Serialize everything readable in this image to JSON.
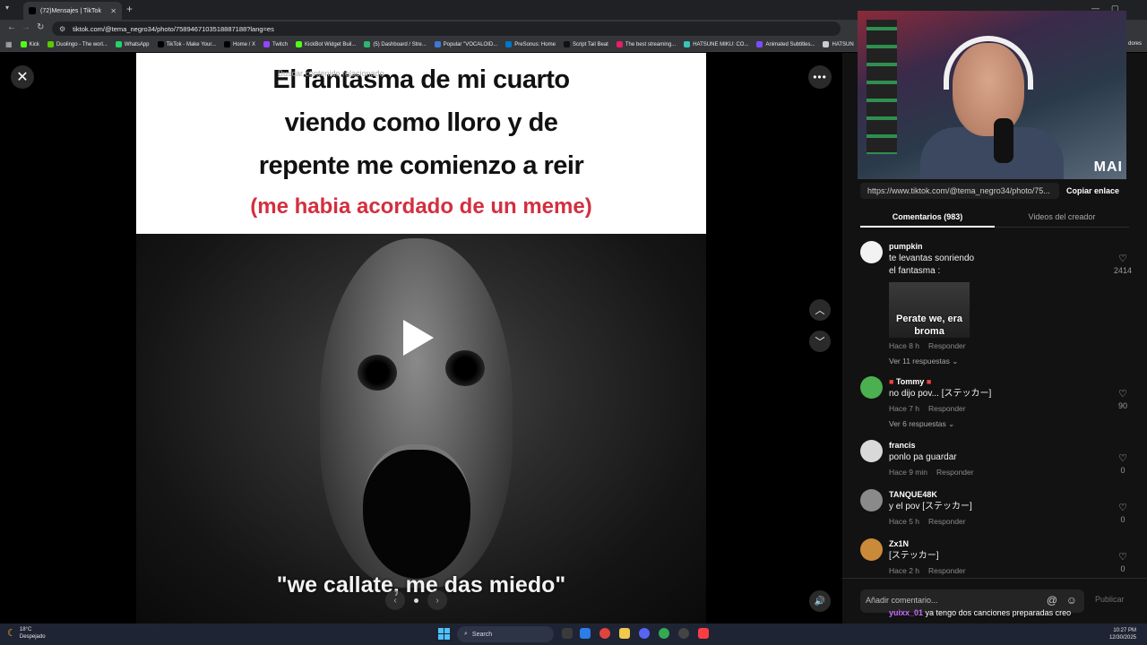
{
  "browser": {
    "tab_title": "(72)Mensajes | TikTok",
    "url": "tiktok.com/@tema_negro34/photo/7589467103518887188?lang=es",
    "bookmarks": [
      {
        "label": "Kick",
        "color": "#53fc18"
      },
      {
        "label": "Duolingo - The worl...",
        "color": "#58cc02"
      },
      {
        "label": "WhatsApp",
        "color": "#25d366"
      },
      {
        "label": "TikTok - Make Your...",
        "color": "#000000"
      },
      {
        "label": "Home / X",
        "color": "#000000"
      },
      {
        "label": "Twitch",
        "color": "#9146ff"
      },
      {
        "label": "KickBot Widget Buil...",
        "color": "#53fc18"
      },
      {
        "label": "(5) Dashboard / Stre...",
        "color": "#2bb673"
      },
      {
        "label": "Popular \"VOCALOID...",
        "color": "#3c78d8"
      },
      {
        "label": "PreSonus: Home",
        "color": "#0077c8"
      },
      {
        "label": "Script Tail Beat",
        "color": "#111111"
      },
      {
        "label": "The best streaming...",
        "color": "#e91e63"
      },
      {
        "label": "HATSUNE MIKU: CO...",
        "color": "#39c5bb"
      },
      {
        "label": "Animated Subtitles...",
        "color": "#7c4dff"
      },
      {
        "label": "HATSUN",
        "color": "#cccccc"
      }
    ],
    "bookmarks_right": "dores"
  },
  "viewer": {
    "search_overlay": "Buscar contenido relacionado",
    "caption_lines": [
      "El fantasma de mi cuarto",
      "viendo como lloro y de",
      "repente me comienzo a reir"
    ],
    "caption_sub": "(me habia acordado de un meme)",
    "meme_text": "\"we callate, me das miedo\""
  },
  "webcam": {
    "logo": "MAI"
  },
  "share": {
    "link": "https://www.tiktok.com/@tema_negro34/photo/75...",
    "copy_label": "Copiar enlace"
  },
  "tabs": {
    "comments": "Comentarios (983)",
    "creator_videos": "Videos del creador"
  },
  "comments": [
    {
      "user": "pumpkin",
      "text1": "te levantas sonriendo",
      "text2": "el fantasma :",
      "sticker_text": "Perate we, era broma",
      "time": "Hace 8 h",
      "reply": "Responder",
      "replies": "Ver 11 respuestas",
      "likes": "2414"
    },
    {
      "user": "Tommy",
      "text1": "no dijo pov... [ステッカー]",
      "time": "Hace 7 h",
      "reply": "Responder",
      "replies": "Ver 6 respuestas",
      "likes": "90"
    },
    {
      "user": "francis",
      "text1": "ponlo pa guardar",
      "time": "Hace 9 min",
      "reply": "Responder",
      "likes": "0"
    },
    {
      "user": "TANQUE48K",
      "text1": "y el pov [ステッカー]",
      "time": "Hace 5 h",
      "reply": "Responder",
      "likes": "0"
    },
    {
      "user": "Zx1N",
      "text1": "[ステッカー]",
      "time": "Hace 2 h",
      "reply": "Responder",
      "likes": "0"
    }
  ],
  "composer": {
    "placeholder": "Añadir comentario...",
    "publish": "Publicar"
  },
  "chat_overlay": {
    "user": "yuixx_01",
    "message": "ya tengo dos canciones preparadas creo"
  },
  "taskbar": {
    "temp": "18°C",
    "weather": "Despejado",
    "search": "Search",
    "time": "10:27 PM",
    "date": "12/30/2025"
  }
}
